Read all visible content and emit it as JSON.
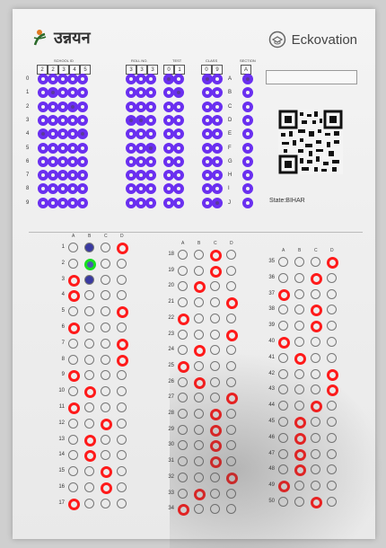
{
  "header": {
    "left_brand": "उन्नयन",
    "right_brand": "Eckovation"
  },
  "id_section": {
    "labels": [
      "SCHOOL ID",
      "ROLL NO.",
      "TEST",
      "CLASS",
      "SECTION"
    ],
    "school_id": [
      "2",
      "2",
      "3",
      "4",
      "5"
    ],
    "roll_no": [
      "3",
      "3",
      "3"
    ],
    "test": [
      "0",
      "1"
    ],
    "class": [
      "0",
      "9"
    ],
    "section": [
      "A"
    ],
    "row_digits": [
      "0",
      "1",
      "2",
      "3",
      "4",
      "5",
      "6",
      "7",
      "8",
      "9"
    ],
    "section_letters": [
      "A",
      "B",
      "C",
      "D",
      "E",
      "F",
      "G",
      "H",
      "I",
      "J"
    ]
  },
  "state_label": "State:BIHAR",
  "answer_columns": {
    "headers": [
      "A",
      "B",
      "C",
      "D"
    ],
    "col1": {
      "start": 1,
      "end": 17,
      "answers": [
        "D",
        "B",
        "A",
        "A",
        "D",
        "A",
        "D",
        "D",
        "A",
        "B",
        "A",
        "C",
        "B",
        "B",
        "C",
        "C",
        "A"
      ]
    },
    "col2": {
      "start": 18,
      "end": 34,
      "answers": [
        "C",
        "C",
        "B",
        "D",
        "A",
        "D",
        "B",
        "A",
        "B",
        "D",
        "C",
        "C",
        "C",
        "C",
        "D",
        "B",
        "A"
      ]
    },
    "col3": {
      "start": 35,
      "end": 50,
      "answers": [
        "D",
        "C",
        "A",
        "C",
        "C",
        "A",
        "B",
        "D",
        "D",
        "C",
        "B",
        "B",
        "B",
        "B",
        "A",
        "C"
      ]
    }
  },
  "colors": {
    "purple": "#6a2ff0",
    "red": "#ff1a1a",
    "green": "#18e020"
  }
}
